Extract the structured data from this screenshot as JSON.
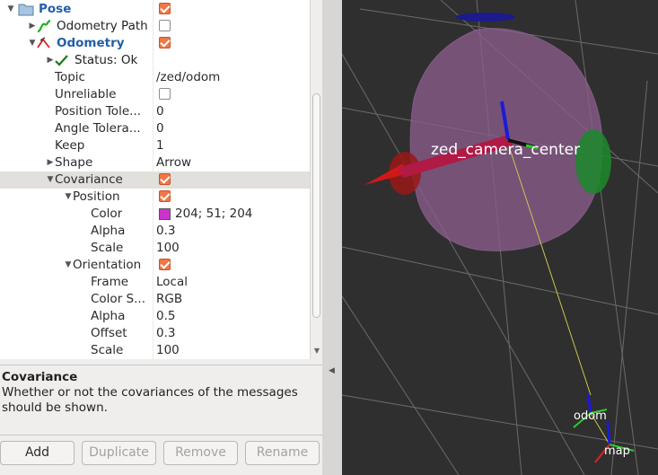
{
  "tree": {
    "rows": [
      {
        "label": "Pose",
        "style": "blue",
        "expanded": true,
        "icon": "folder-icon",
        "control": "checkbox",
        "checked": true
      },
      {
        "label": "Odometry Path",
        "style": "dark",
        "expanded": false,
        "icon": "path-display-icon",
        "control": "checkbox",
        "checked": false
      },
      {
        "label": "Odometry",
        "style": "blue",
        "expanded": true,
        "icon": "odometry-display-icon",
        "control": "checkbox",
        "checked": true
      },
      {
        "label": "Status: Ok",
        "style": "dark",
        "expanded": false,
        "icon": "status-ok-icon",
        "control": "none"
      },
      {
        "label": "Topic",
        "value": "/zed/odom"
      },
      {
        "label": "Unreliable",
        "control": "checkbox",
        "checked": false
      },
      {
        "label": "Position Tole...",
        "value": "0"
      },
      {
        "label": "Angle Tolera...",
        "value": "0"
      },
      {
        "label": "Keep",
        "value": "1"
      },
      {
        "label": "Shape",
        "expanded": false,
        "value": "Arrow"
      },
      {
        "label": "Covariance",
        "expanded": true,
        "control": "checkbox",
        "checked": true,
        "selected": true
      },
      {
        "label": "Position",
        "expanded": true,
        "control": "checkbox",
        "checked": true
      },
      {
        "label": "Color",
        "control": "color",
        "color": "#cc33cc",
        "value": "204; 51; 204"
      },
      {
        "label": "Alpha",
        "value": "0.3"
      },
      {
        "label": "Scale",
        "value": "100"
      },
      {
        "label": "Orientation",
        "expanded": true,
        "control": "checkbox",
        "checked": true
      },
      {
        "label": "Frame",
        "value": "Local"
      },
      {
        "label": "Color S...",
        "value": "RGB"
      },
      {
        "label": "Alpha",
        "value": "0.5"
      },
      {
        "label": "Offset",
        "value": "0.3"
      },
      {
        "label": "Scale",
        "value": "100"
      }
    ]
  },
  "help": {
    "title": "Covariance",
    "text": "Whether or not the covariances of the messages should be shown."
  },
  "buttons": {
    "add": "Add",
    "duplicate": "Duplicate",
    "remove": "Remove",
    "rename": "Rename"
  },
  "viewport": {
    "frame_labels": {
      "camera": "zed_camera_center",
      "odom": "odom",
      "map": "map"
    },
    "colors": {
      "background": "#2f2f2f",
      "covariance": "#8a5c8c",
      "arrow": "#d01818",
      "link": "#c8c850"
    }
  }
}
